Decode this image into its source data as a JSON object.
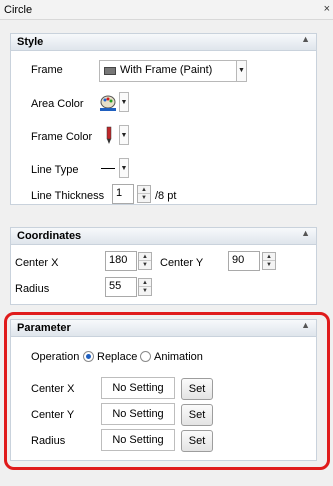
{
  "window": {
    "title": "Circle",
    "close_glyph": "×"
  },
  "style": {
    "header": "Style",
    "frame_label": "Frame",
    "frame_value": "With Frame (Paint)",
    "area_color_label": "Area Color",
    "frame_color_label": "Frame Color",
    "line_type_label": "Line Type",
    "line_thickness_label": "Line Thickness",
    "line_thickness_value": "1",
    "line_thickness_unit": "/8 pt"
  },
  "coordinates": {
    "header": "Coordinates",
    "center_x_label": "Center X",
    "center_x_value": "180",
    "center_y_label": "Center Y",
    "center_y_value": "90",
    "radius_label": "Radius",
    "radius_value": "55"
  },
  "parameter": {
    "header": "Parameter",
    "operation_label": "Operation",
    "option_replace": "Replace",
    "option_animation": "Animation",
    "selected_option": "Replace",
    "rows": [
      {
        "label": "Center X",
        "value": "No Setting",
        "button": "Set"
      },
      {
        "label": "Center Y",
        "value": "No Setting",
        "button": "Set"
      },
      {
        "label": "Radius",
        "value": "No Setting",
        "button": "Set"
      }
    ]
  },
  "colors": {
    "highlight": "#e01b1b",
    "frame_color_swatch": "#c0282b"
  },
  "icons": [
    "close-icon",
    "collapse-caret-icon",
    "frame-style-icon",
    "paint-palette-icon",
    "pen-icon",
    "line-type-icon",
    "spin-up-icon",
    "spin-down-icon"
  ]
}
